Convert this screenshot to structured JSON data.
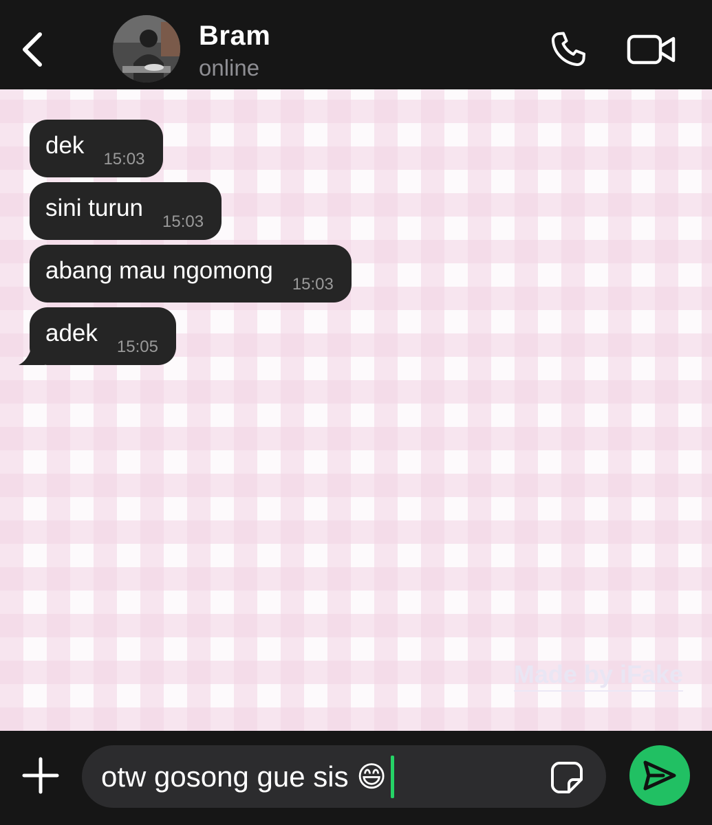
{
  "header": {
    "back_icon": "chevron-left-icon",
    "contact_name": "Bram",
    "contact_status": "online",
    "call_icon": "phone-icon",
    "video_icon": "video-camera-icon"
  },
  "messages": [
    {
      "text": "dek",
      "time": "15:03",
      "direction": "incoming"
    },
    {
      "text": "sini turun",
      "time": "15:03",
      "direction": "incoming"
    },
    {
      "text": "abang mau ngomong",
      "time": "15:03",
      "direction": "incoming"
    },
    {
      "text": "adek",
      "time": "15:05",
      "direction": "incoming"
    }
  ],
  "watermark": "Made by iFake",
  "composer": {
    "attach_icon": "plus-icon",
    "text": "otw gosong gue sis 😄",
    "sticker_icon": "sticker-icon",
    "send_icon": "send-icon"
  },
  "colors": {
    "header_bg": "#161616",
    "bubble_bg": "#252525",
    "send_button": "#21c063",
    "caret": "#25d366",
    "gingham": "#f2d4e4"
  }
}
